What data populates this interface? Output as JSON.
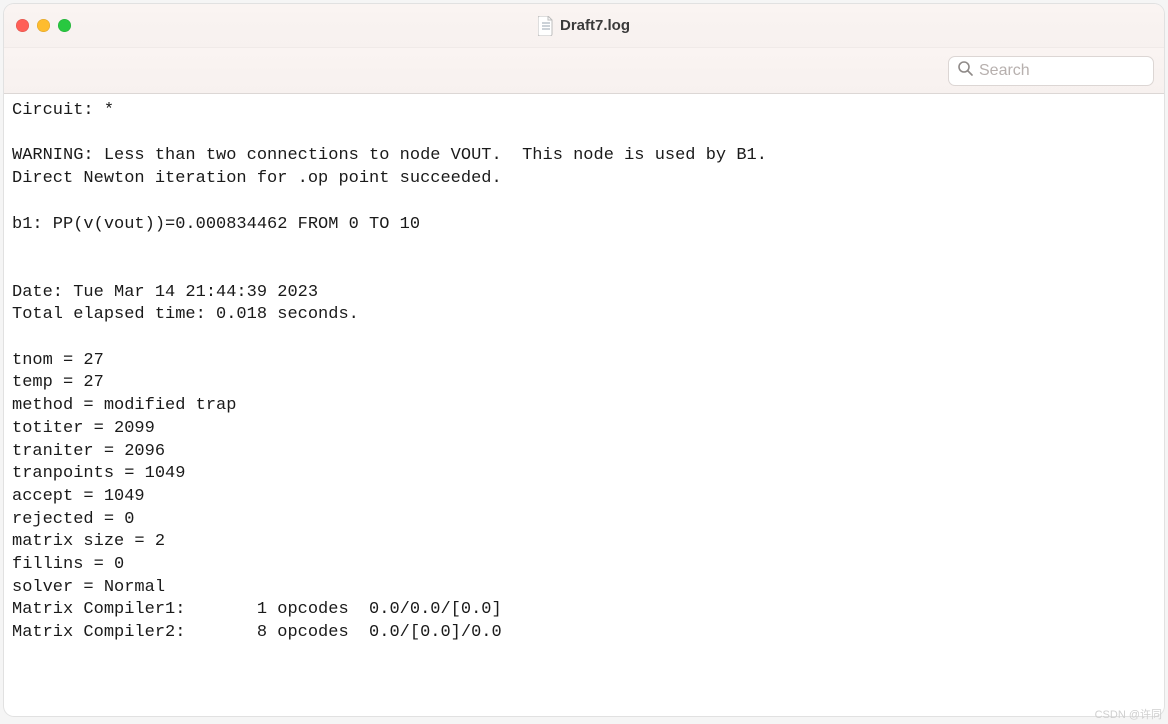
{
  "window": {
    "title": "Draft7.log"
  },
  "toolbar": {
    "search_placeholder": "Search"
  },
  "log": {
    "lines": [
      "Circuit: *",
      "",
      "WARNING: Less than two connections to node VOUT.  This node is used by B1.",
      "Direct Newton iteration for .op point succeeded.",
      "",
      "b1: PP(v(vout))=0.000834462 FROM 0 TO 10",
      "",
      "",
      "Date: Tue Mar 14 21:44:39 2023",
      "Total elapsed time: 0.018 seconds.",
      "",
      "tnom = 27",
      "temp = 27",
      "method = modified trap",
      "totiter = 2099",
      "traniter = 2096",
      "tranpoints = 1049",
      "accept = 1049",
      "rejected = 0",
      "matrix size = 2",
      "fillins = 0",
      "solver = Normal",
      "Matrix Compiler1:       1 opcodes  0.0/0.0/[0.0]",
      "Matrix Compiler2:       8 opcodes  0.0/[0.0]/0.0"
    ]
  },
  "watermark": "CSDN @许同"
}
